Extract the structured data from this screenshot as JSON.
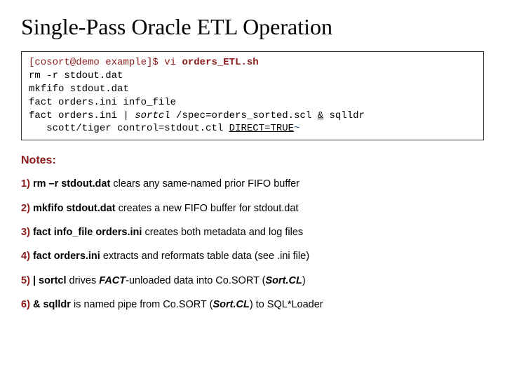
{
  "title": "Single-Pass Oracle ETL Operation",
  "code": {
    "prompt": "[cosort@demo example]$",
    "vi": "vi",
    "filename": "orders_ETL.sh",
    "line1": "rm -r stdout.dat",
    "line2": "mkfifo stdout.dat",
    "line3": "fact orders.ini info_file",
    "line4a": "fact orders.ini | ",
    "line4b": "sortcl",
    "line4c": " /spec=orders_sorted.scl ",
    "line4d": "&",
    "line4e": " sqlldr",
    "line5a": "   scott/tiger control=stdout.ctl ",
    "line5b": "DIRECT=TRUE",
    "tilde": "~"
  },
  "notes_heading": "Notes:",
  "notes": [
    {
      "num": "1)",
      "kw": "rm –r stdout.dat",
      "desc": " clears any same-named prior FIFO buffer"
    },
    {
      "num": "2)",
      "kw": "mkfifo stdout.dat",
      "desc": " creates a new FIFO buffer for stdout.dat"
    },
    {
      "num": "3)",
      "kw": "fact info_file orders.ini",
      "desc": " creates both metadata and log files"
    },
    {
      "num": "4)",
      "kw": "fact orders.ini",
      "desc": " extracts and reformats table data (see .ini file)"
    },
    {
      "num": "5)",
      "kw": "| sortcl",
      "pre": " drives ",
      "ital1": "FACT",
      "mid": "-unloaded data into Co.SORT (",
      "ital2": "Sort.CL",
      "post": ")"
    },
    {
      "num": "6)",
      "kw": "& sqlldr",
      "pre": " is named pipe from Co.SORT (",
      "ital1": "Sort.CL",
      "post": ") to SQL*Loader"
    }
  ]
}
